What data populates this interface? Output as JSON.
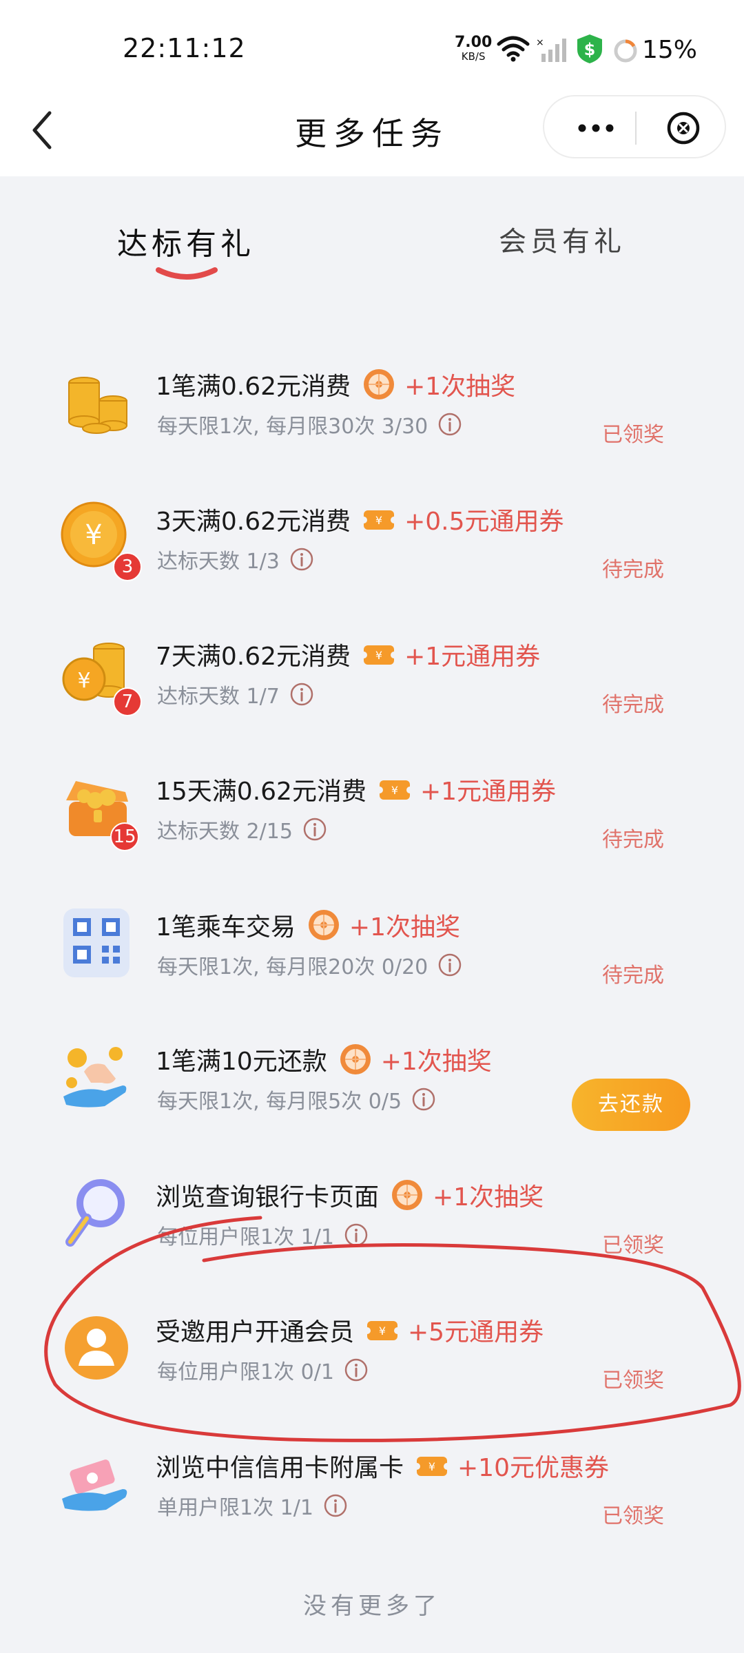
{
  "status_bar": {
    "time": "22:11:12",
    "net_speed_value": "7.00",
    "net_speed_unit": "KB/S",
    "battery": "15%",
    "icons": [
      "wifi-icon",
      "signal-icon",
      "shield-dollar-icon",
      "battery-ring-icon"
    ]
  },
  "nav": {
    "title": "更多任务",
    "icons": [
      "back-chevron-icon",
      "more-dots-icon",
      "close-circle-icon"
    ]
  },
  "tabs": [
    {
      "label": "达标有礼",
      "active": true
    },
    {
      "label": "会员有礼",
      "active": false
    }
  ],
  "tasks": [
    {
      "title": "1笔满0.62元消费",
      "reward_type": "lottery",
      "reward": "+1次抽奖",
      "subtitle": "每天限1次, 每月限30次 3/30",
      "status": "已领奖",
      "icon": "coin-stack-icon"
    },
    {
      "title": "3天满0.62元消费",
      "reward_type": "coupon",
      "reward": "+0.5元通用券",
      "subtitle": "达标天数 1/3",
      "status": "待完成",
      "icon": "yuan-coin-icon",
      "badge": "3"
    },
    {
      "title": "7天满0.62元消费",
      "reward_type": "coupon",
      "reward": "+1元通用券",
      "subtitle": "达标天数 1/7",
      "status": "待完成",
      "icon": "coin-stack-yuan-icon",
      "badge": "7"
    },
    {
      "title": "15天满0.62元消费",
      "reward_type": "coupon",
      "reward": "+1元通用券",
      "subtitle": "达标天数 2/15",
      "status": "待完成",
      "icon": "treasure-box-icon",
      "badge": "15"
    },
    {
      "title": "1笔乘车交易",
      "reward_type": "lottery",
      "reward": "+1次抽奖",
      "subtitle": "每天限1次, 每月限20次 0/20",
      "status": "待完成",
      "icon": "qr-code-icon"
    },
    {
      "title": "1笔满10元还款",
      "reward_type": "lottery",
      "reward": "+1次抽奖",
      "subtitle": "每天限1次, 每月限5次 0/5",
      "button": "去还款",
      "icon": "hand-coins-icon"
    },
    {
      "title": "浏览查询银行卡页面",
      "reward_type": "lottery",
      "reward": "+1次抽奖",
      "subtitle": "每位用户限1次 1/1",
      "status": "已领奖",
      "icon": "magnifier-icon"
    },
    {
      "title": "受邀用户开通会员",
      "reward_type": "coupon",
      "reward": "+5元通用券",
      "subtitle": "每位用户限1次 0/1",
      "status": "已领奖",
      "icon": "user-avatar-icon"
    },
    {
      "title": "浏览中信信用卡附属卡",
      "reward_type": "coupon",
      "reward": "+10元优惠券",
      "subtitle": "单用户限1次 1/1",
      "status": "已领奖",
      "icon": "hand-card-icon"
    }
  ],
  "footer": {
    "no_more": "没有更多了"
  },
  "colors": {
    "reward_red": "#e2554e",
    "status_red": "#e0726a",
    "button_orange": "#f7a524",
    "annotation_red": "#d93a3a"
  }
}
